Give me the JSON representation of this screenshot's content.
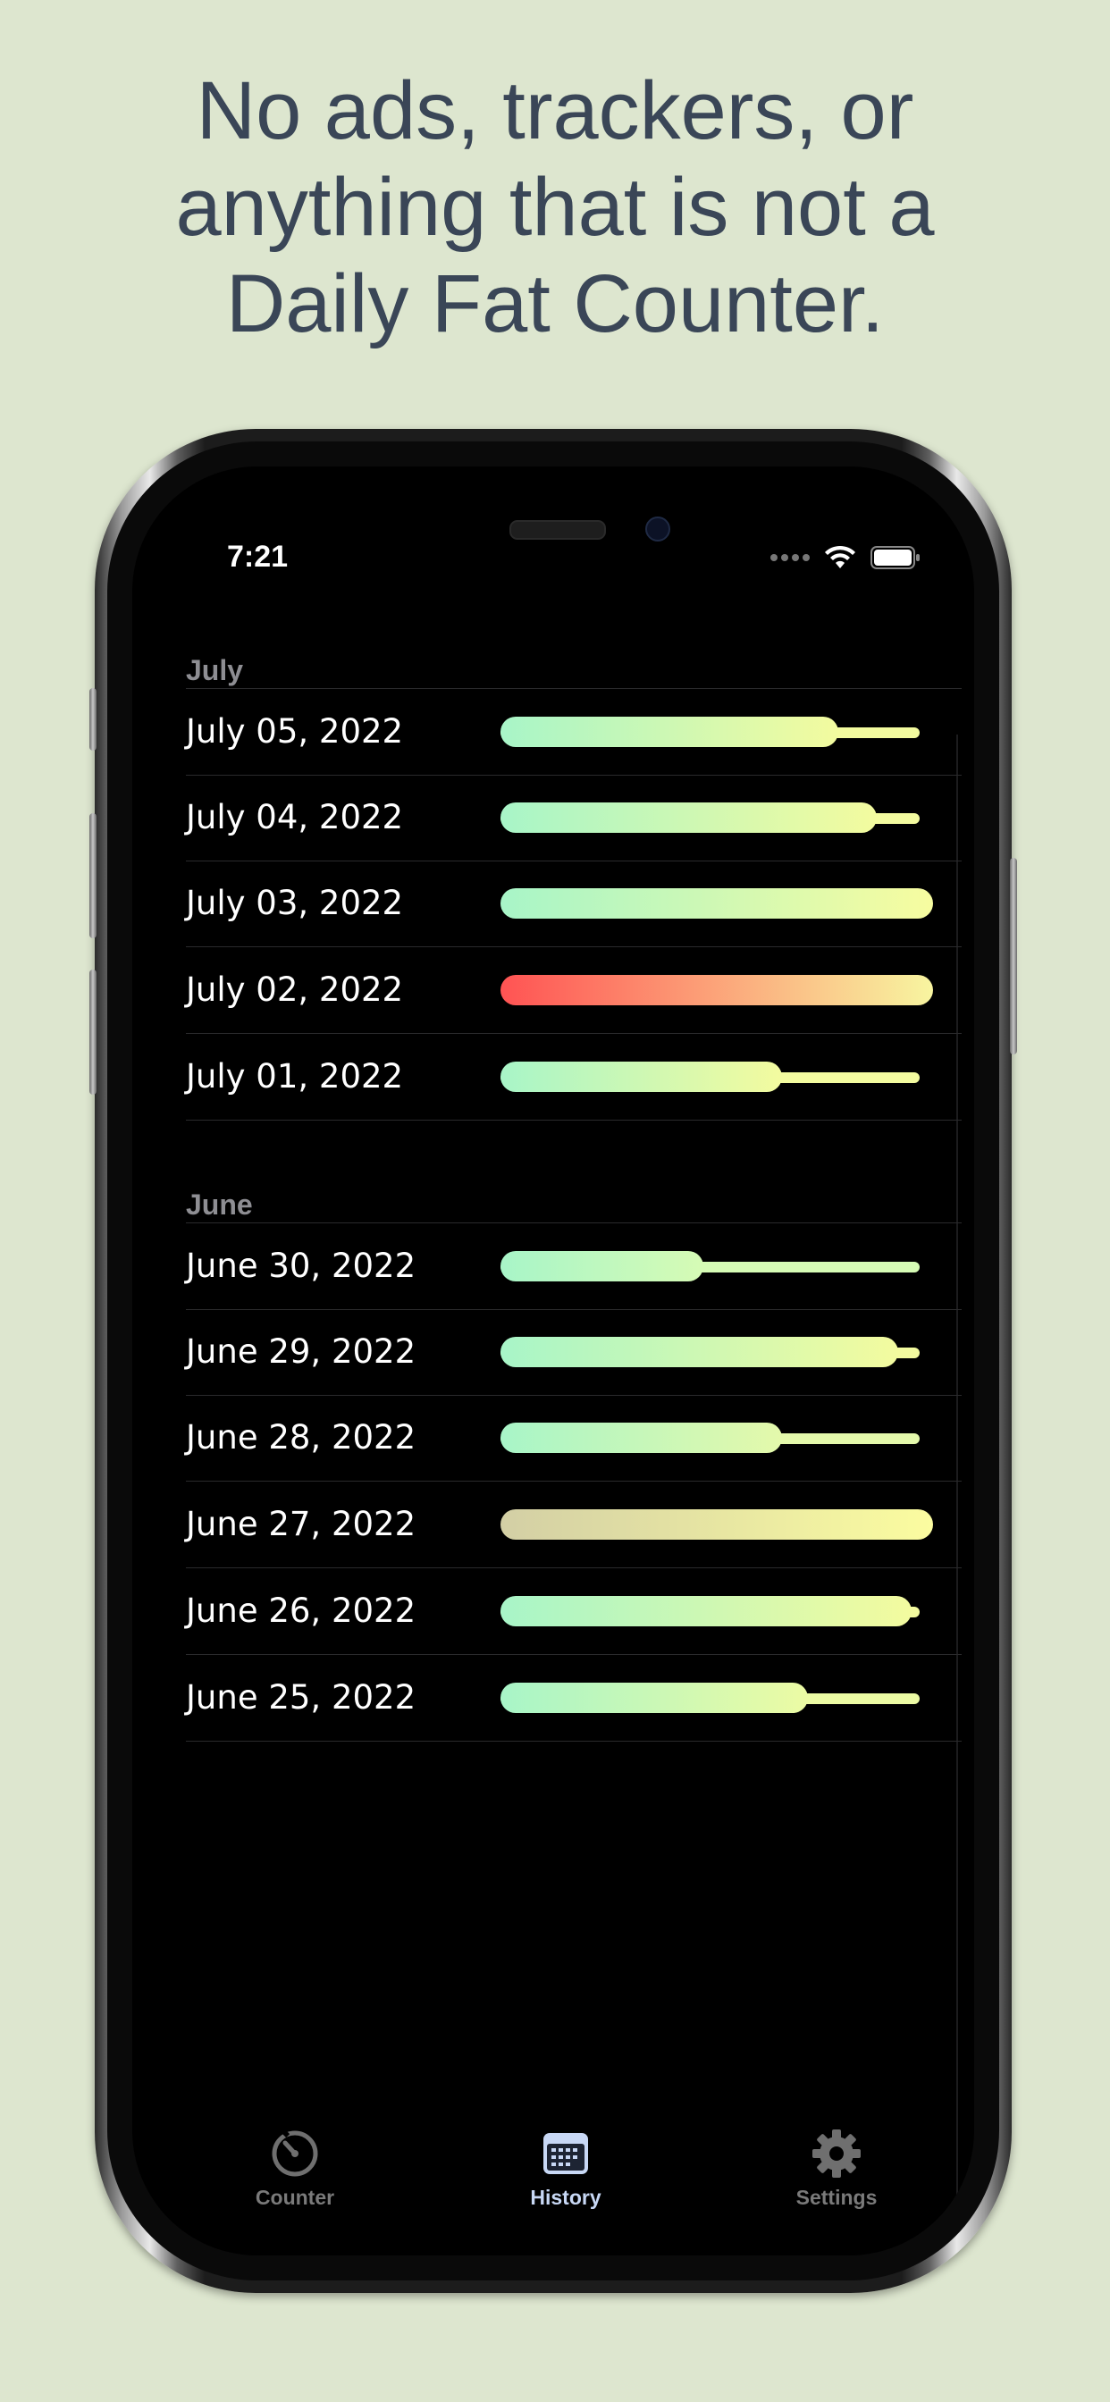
{
  "headline": [
    "No ads, trackers, or",
    "anything that is not a",
    "Daily Fat Counter."
  ],
  "status_bar": {
    "time": "7:21"
  },
  "sections": [
    {
      "title": "July",
      "rows": [
        {
          "date": "July 05, 2022",
          "fill": 0.78,
          "track": 0.97,
          "colors": [
            "#a8f5c8",
            "#f3fb9f"
          ]
        },
        {
          "date": "July 04, 2022",
          "fill": 0.87,
          "track": 0.97,
          "colors": [
            "#a8f5c8",
            "#f3fb9f"
          ]
        },
        {
          "date": "July 03, 2022",
          "fill": 1.0,
          "track": 0.97,
          "colors": [
            "#a8f5c8",
            "#f7fca0"
          ]
        },
        {
          "date": "July 02, 2022",
          "fill": 1.0,
          "track": 0.97,
          "colors": [
            "#ff5353",
            "#f8f5a0"
          ]
        },
        {
          "date": "July 01, 2022",
          "fill": 0.65,
          "track": 0.97,
          "colors": [
            "#a8f5c8",
            "#f3fb9f"
          ]
        }
      ]
    },
    {
      "title": "June",
      "rows": [
        {
          "date": "June 30, 2022",
          "fill": 0.47,
          "track": 0.97,
          "colors": [
            "#a8f5c8",
            "#d6fbb5"
          ]
        },
        {
          "date": "June 29, 2022",
          "fill": 0.92,
          "track": 0.97,
          "colors": [
            "#a8f5c8",
            "#f3fb9f"
          ]
        },
        {
          "date": "June 28, 2022",
          "fill": 0.65,
          "track": 0.97,
          "colors": [
            "#a8f5c8",
            "#e4f9ab"
          ]
        },
        {
          "date": "June 27, 2022",
          "fill": 1.0,
          "track": 0.97,
          "colors": [
            "#d3cfa5",
            "#fbfca0"
          ]
        },
        {
          "date": "June 26, 2022",
          "fill": 0.95,
          "track": 0.97,
          "colors": [
            "#a8f5c8",
            "#f3fb9f"
          ]
        },
        {
          "date": "June 25, 2022",
          "fill": 0.71,
          "track": 0.97,
          "colors": [
            "#a8f5c8",
            "#ecfba4"
          ]
        }
      ]
    }
  ],
  "tabs": [
    {
      "label": "Counter",
      "icon": "gauge-icon",
      "active": false
    },
    {
      "label": "History",
      "icon": "calendar-icon",
      "active": true
    },
    {
      "label": "Settings",
      "icon": "gear-icon",
      "active": false
    }
  ],
  "colors": {
    "background": "#dde6cf",
    "headline": "#3a4657",
    "active_tab": "#c8d8f5",
    "inactive_tab": "#7a7a7a"
  }
}
